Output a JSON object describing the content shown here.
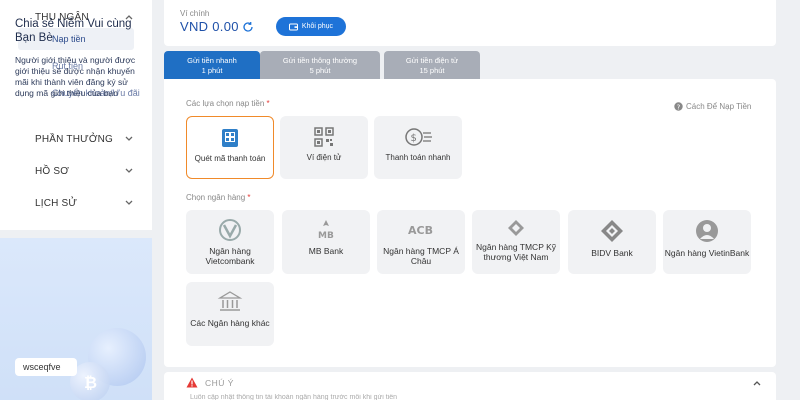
{
  "sidebar": {
    "sections": [
      {
        "label": "THU NGÂN"
      },
      {
        "label": "PHẦN THƯỞNG"
      },
      {
        "label": "HỒ SƠ"
      },
      {
        "label": "LỊCH SỬ"
      }
    ],
    "sub_items": [
      {
        "label": "Nạp tiền",
        "active": true
      },
      {
        "label": "Rút tiền"
      },
      {
        "label": "Chuyển khoản/Ưu đãi"
      }
    ]
  },
  "promo": {
    "title": "Chia sẻ Niềm Vui cùng Bạn Bè",
    "text": "Người giới thiệu và người được giới thiệu sẽ được nhận khuyến mãi khi thành viên đăng ký sử dụng mã giới thiệu của bạn",
    "code": "wsceqfve"
  },
  "wallet": {
    "label": "Ví chính",
    "value": "VND 0.00",
    "restore_label": "Khôi phục"
  },
  "tabs": [
    {
      "title": "Gửi tiền nhanh",
      "sub": "1 phút",
      "active": true
    },
    {
      "title": "Gửi tiền thông thường",
      "sub": "5 phút"
    },
    {
      "title": "Gửi tiền điện tử",
      "sub": "15 phút"
    }
  ],
  "options_section": {
    "label": "Các lựa chọn nạp tiền",
    "required_mark": "*",
    "help": "Cách Để Nạp Tiền",
    "options": [
      {
        "label": "Quét mã thanh toán",
        "icon": "qr-scan-icon",
        "selected": true
      },
      {
        "label": "Ví điện tử",
        "icon": "qr-code-icon"
      },
      {
        "label": "Thanh toán nhanh",
        "icon": "fast-payment-icon"
      }
    ]
  },
  "bank_section": {
    "label": "Chọn ngân hàng",
    "required_mark": "*",
    "banks": [
      {
        "label": "Ngân hàng Vietcombank",
        "icon": "vietcombank-logo"
      },
      {
        "label": "MB Bank",
        "icon": "mbbank-logo"
      },
      {
        "label": "Ngân hàng TMCP Á Châu",
        "icon": "acb-logo"
      },
      {
        "label": "Ngân hàng TMCP Kỹ thương Việt Nam",
        "icon": "techcombank-logo"
      },
      {
        "label": "BIDV Bank",
        "icon": "bidv-logo"
      },
      {
        "label": "Ngân hàng VietinBank",
        "icon": "vietinbank-logo"
      },
      {
        "label": "Các Ngân hàng khác",
        "icon": "bank-building-icon"
      }
    ]
  },
  "notice": {
    "title": "CHÚ Ý",
    "text": "Luôn cập nhật thông tin tài khoản ngân hàng trước mỗi khi gửi tiền"
  },
  "colors": {
    "primary": "#1f6fc4",
    "selected_border": "#f08a2a",
    "tab_inactive": "#a8adb7",
    "warning": "#e53935"
  }
}
